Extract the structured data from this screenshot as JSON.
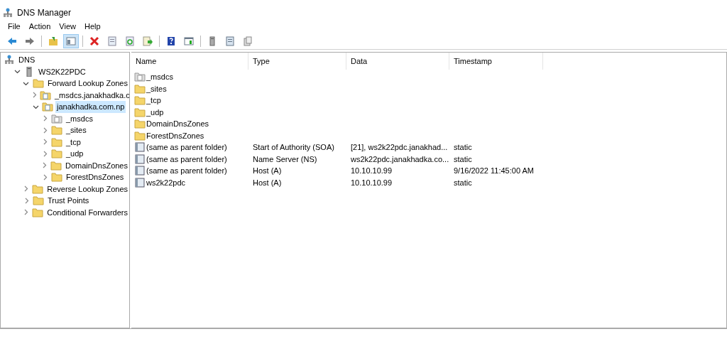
{
  "window": {
    "title": "DNS Manager"
  },
  "menu": [
    "File",
    "Action",
    "View",
    "Help"
  ],
  "toolbar": [
    {
      "kind": "back",
      "pressed": false
    },
    {
      "kind": "forward",
      "pressed": false
    },
    {
      "kind": "separator"
    },
    {
      "kind": "up",
      "pressed": false
    },
    {
      "kind": "pane",
      "pressed": true
    },
    {
      "kind": "separator"
    },
    {
      "kind": "delete",
      "pressed": false
    },
    {
      "kind": "properties",
      "pressed": false
    },
    {
      "kind": "refresh",
      "pressed": false
    },
    {
      "kind": "export",
      "pressed": false
    },
    {
      "kind": "separator"
    },
    {
      "kind": "help",
      "pressed": false
    },
    {
      "kind": "console",
      "pressed": false
    },
    {
      "kind": "separator"
    },
    {
      "kind": "server",
      "pressed": false
    },
    {
      "kind": "list",
      "pressed": false
    },
    {
      "kind": "copy",
      "pressed": false
    }
  ],
  "tree": [
    {
      "label": "DNS",
      "kind": "dns",
      "selected": false,
      "children": [
        {
          "label": "WS2K22PDC",
          "kind": "server",
          "expanded": true,
          "selected": false,
          "children": [
            {
              "label": "Forward Lookup Zones",
              "kind": "folder",
              "expanded": true,
              "selected": false,
              "children": [
                {
                  "label": "_msdcs.janakhadka.c",
                  "kind": "zone",
                  "expanded": false,
                  "selected": false
                },
                {
                  "label": "janakhadka.com.np",
                  "kind": "zone",
                  "expanded": true,
                  "selected": true,
                  "children": [
                    {
                      "label": "_msdcs",
                      "kind": "delegation",
                      "expanded": false,
                      "selected": false
                    },
                    {
                      "label": "_sites",
                      "kind": "folder",
                      "expanded": false,
                      "selected": false
                    },
                    {
                      "label": "_tcp",
                      "kind": "folder",
                      "expanded": false,
                      "selected": false
                    },
                    {
                      "label": "_udp",
                      "kind": "folder",
                      "expanded": false,
                      "selected": false
                    },
                    {
                      "label": "DomainDnsZones",
                      "kind": "folder",
                      "expanded": false,
                      "selected": false
                    },
                    {
                      "label": "ForestDnsZones",
                      "kind": "folder",
                      "expanded": false,
                      "selected": false
                    }
                  ]
                }
              ]
            },
            {
              "label": "Reverse Lookup Zones",
              "kind": "folder",
              "expanded": false,
              "selected": false
            },
            {
              "label": "Trust Points",
              "kind": "folder",
              "expanded": false,
              "selected": false
            },
            {
              "label": "Conditional Forwarders",
              "kind": "folder",
              "expanded": false,
              "selected": false
            }
          ]
        }
      ]
    }
  ],
  "table": {
    "columns": [
      "Name",
      "Type",
      "Data",
      "Timestamp"
    ],
    "rows": [
      {
        "kind": "delegation",
        "cells": [
          "_msdcs"
        ]
      },
      {
        "kind": "folder",
        "cells": [
          "_sites"
        ]
      },
      {
        "kind": "folder",
        "cells": [
          "_tcp"
        ]
      },
      {
        "kind": "folder",
        "cells": [
          "_udp"
        ]
      },
      {
        "kind": "folder",
        "cells": [
          "DomainDnsZones"
        ]
      },
      {
        "kind": "folder",
        "cells": [
          "ForestDnsZones"
        ]
      },
      {
        "kind": "record",
        "cells": [
          "(same as parent folder)",
          "Start of Authority (SOA)",
          "[21], ws2k22pdc.janakhad...",
          "static"
        ]
      },
      {
        "kind": "record",
        "cells": [
          "(same as parent folder)",
          "Name Server (NS)",
          "ws2k22pdc.janakhadka.co...",
          "static"
        ]
      },
      {
        "kind": "record",
        "cells": [
          "(same as parent folder)",
          "Host (A)",
          "10.10.10.99",
          "9/16/2022 11:45:00 AM"
        ]
      },
      {
        "kind": "record",
        "cells": [
          "ws2k22pdc",
          "Host (A)",
          "10.10.10.99",
          "static"
        ]
      }
    ]
  }
}
